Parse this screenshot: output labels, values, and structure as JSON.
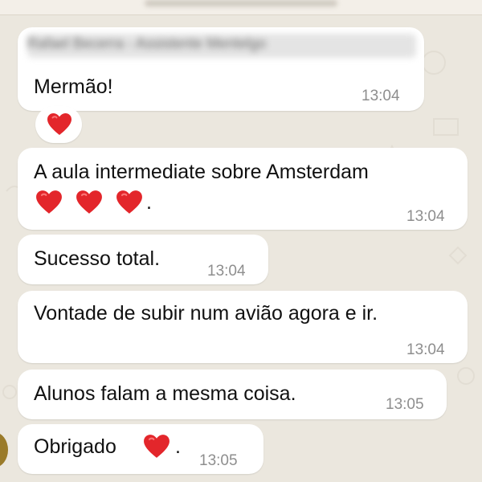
{
  "chat_header": {
    "title": ""
  },
  "sender": {
    "name": "Rafael Becerra - Assistente Mentelgo"
  },
  "messages": [
    {
      "id": "m1",
      "text": "Mermão!",
      "time": "13:04",
      "reaction": "red-heart-emoji"
    },
    {
      "id": "m2",
      "line1": "A aula intermediate sobre Amsterdam",
      "line2_suffix": ".",
      "emojis": [
        "red-heart-emoji",
        "red-heart-emoji",
        "red-heart-emoji"
      ],
      "time": "13:04"
    },
    {
      "id": "m3",
      "text": "Sucesso total.",
      "time": "13:04"
    },
    {
      "id": "m4",
      "text": "Vontade de subir num avião agora e ir.",
      "time": "13:04"
    },
    {
      "id": "m5",
      "text": "Alunos falam a mesma coisa.",
      "time": "13:05"
    },
    {
      "id": "m6",
      "text": "Obrigado",
      "suffix": ".",
      "emojis": [
        "red-heart-emoji"
      ],
      "time": "13:05"
    }
  ],
  "colors": {
    "background": "#ebe7de",
    "bubble": "#ffffff",
    "text": "#111111",
    "timestamp": "#8e8e8e",
    "heart": "#e3262b"
  }
}
